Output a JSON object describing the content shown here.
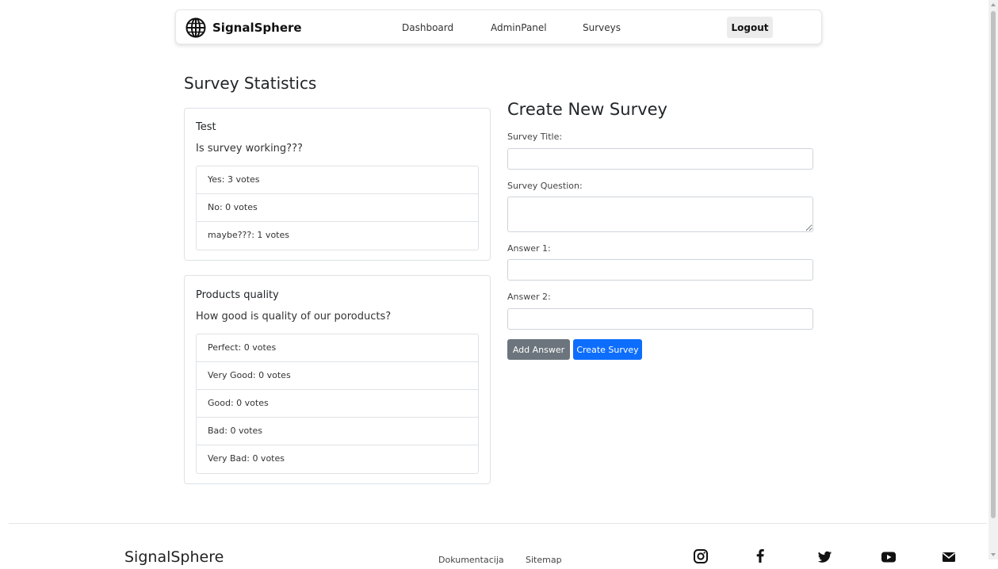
{
  "header": {
    "brand": "SignalSphere",
    "nav": [
      "Dashboard",
      "AdminPanel",
      "Surveys"
    ],
    "logout_label": "Logout"
  },
  "stats": {
    "title": "Survey Statistics",
    "surveys": [
      {
        "title": "Test",
        "question": "Is survey working???",
        "answers": [
          "Yes: 3 votes",
          "No: 0 votes",
          "maybe???: 1 votes"
        ]
      },
      {
        "title": "Products quality",
        "question": "How good is quality of our poroducts?",
        "answers": [
          "Perfect: 0 votes",
          "Very Good: 0 votes",
          "Good: 0 votes",
          "Bad: 0 votes",
          "Very Bad: 0 votes"
        ]
      }
    ]
  },
  "form": {
    "title": "Create New Survey",
    "survey_title_label": "Survey Title:",
    "survey_title_value": "",
    "survey_question_label": "Survey Question:",
    "survey_question_value": "",
    "answer1_label": "Answer 1:",
    "answer1_value": "",
    "answer2_label": "Answer 2:",
    "answer2_value": "",
    "add_answer_label": "Add Answer",
    "create_label": "Create Survey"
  },
  "footer": {
    "brand": "SignalSphere",
    "links": [
      "Dokumentacija",
      "Sitemap"
    ],
    "socials": [
      "instagram-icon",
      "facebook-icon",
      "twitter-icon",
      "youtube-icon",
      "mail-icon"
    ]
  },
  "colors": {
    "primary": "#0d6efd",
    "secondary": "#6c757d",
    "border": "#dee2e6"
  }
}
